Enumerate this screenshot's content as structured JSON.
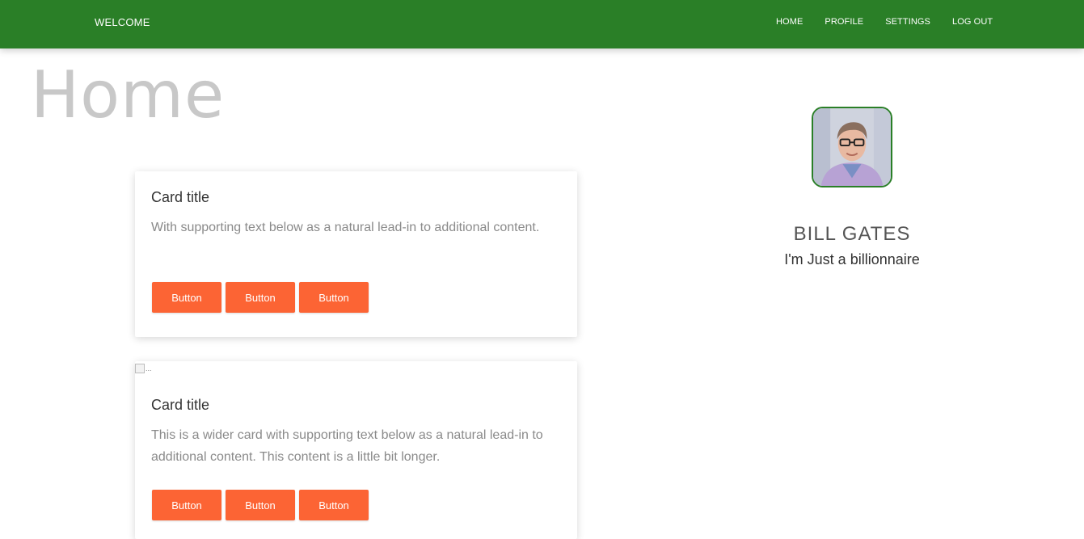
{
  "navbar": {
    "brand": "WELCOME",
    "links": [
      "HOME",
      "PROFILE",
      "SETTINGS",
      "LOG OUT"
    ],
    "background": "#2a7f27"
  },
  "page": {
    "title": "Home"
  },
  "cards": [
    {
      "title": "Card title",
      "text": "With supporting text below as a natural lead-in to additional content.",
      "buttons": [
        "Button",
        "Button",
        "Button"
      ]
    },
    {
      "image_alt": "...",
      "title": "Card title",
      "text": "This is a wider card with supporting text below as a natural lead-in to additional content. This content is a little bit longer.",
      "buttons": [
        "Button",
        "Button",
        "Button"
      ]
    }
  ],
  "profile": {
    "name": "BILL GATES",
    "tagline": "I'm Just a billionnaire"
  },
  "colors": {
    "accent_button": "#fc6434",
    "nav_green": "#2a7f27"
  }
}
